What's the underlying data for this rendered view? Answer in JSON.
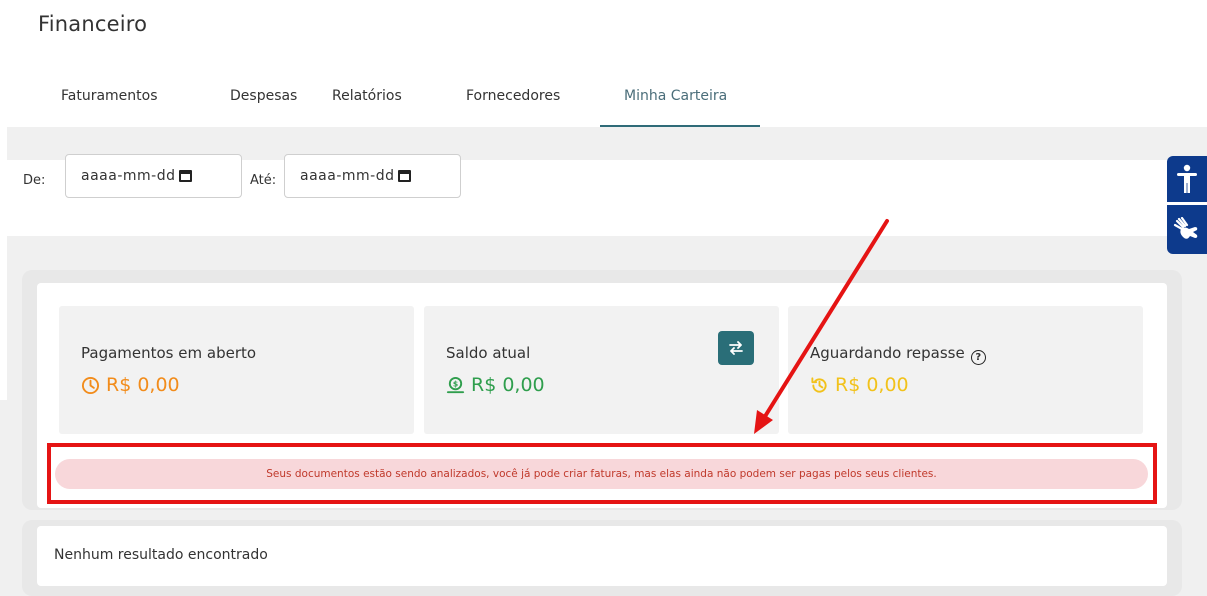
{
  "page": {
    "title": "Financeiro"
  },
  "tabs": [
    {
      "label": "Faturamentos"
    },
    {
      "label": "Despesas"
    },
    {
      "label": "Relatórios"
    },
    {
      "label": "Fornecedores"
    },
    {
      "label": "Minha Carteira",
      "active": true
    }
  ],
  "filters": {
    "from_label": "De:",
    "from_placeholder": "aaaa-mm-dd",
    "to_label": "Até:",
    "to_placeholder": "aaaa-mm-dd"
  },
  "stats": {
    "open_payments": {
      "label": "Pagamentos em aberto",
      "value": "R$ 0,00",
      "color": "#f28c1b",
      "icon": "clock-icon"
    },
    "balance": {
      "label": "Saldo atual",
      "value": "R$ 0,00",
      "color": "#2f9e4d",
      "icon": "money-icon"
    },
    "pending_transfer": {
      "label": "Aguardando repasse",
      "value": "R$ 0,00",
      "color": "#f2c21b",
      "icon": "history-icon"
    }
  },
  "alert": {
    "message": "Seus documentos estão sendo analizados, você já pode criar faturas, mas elas ainda não podem ser pagas pelos seus clientes."
  },
  "results": {
    "empty_text": "Nenhum resultado encontrado"
  },
  "colors": {
    "accent": "#2a6e78",
    "annotation": "#e51414",
    "accessibility": "#0d3a8c"
  }
}
